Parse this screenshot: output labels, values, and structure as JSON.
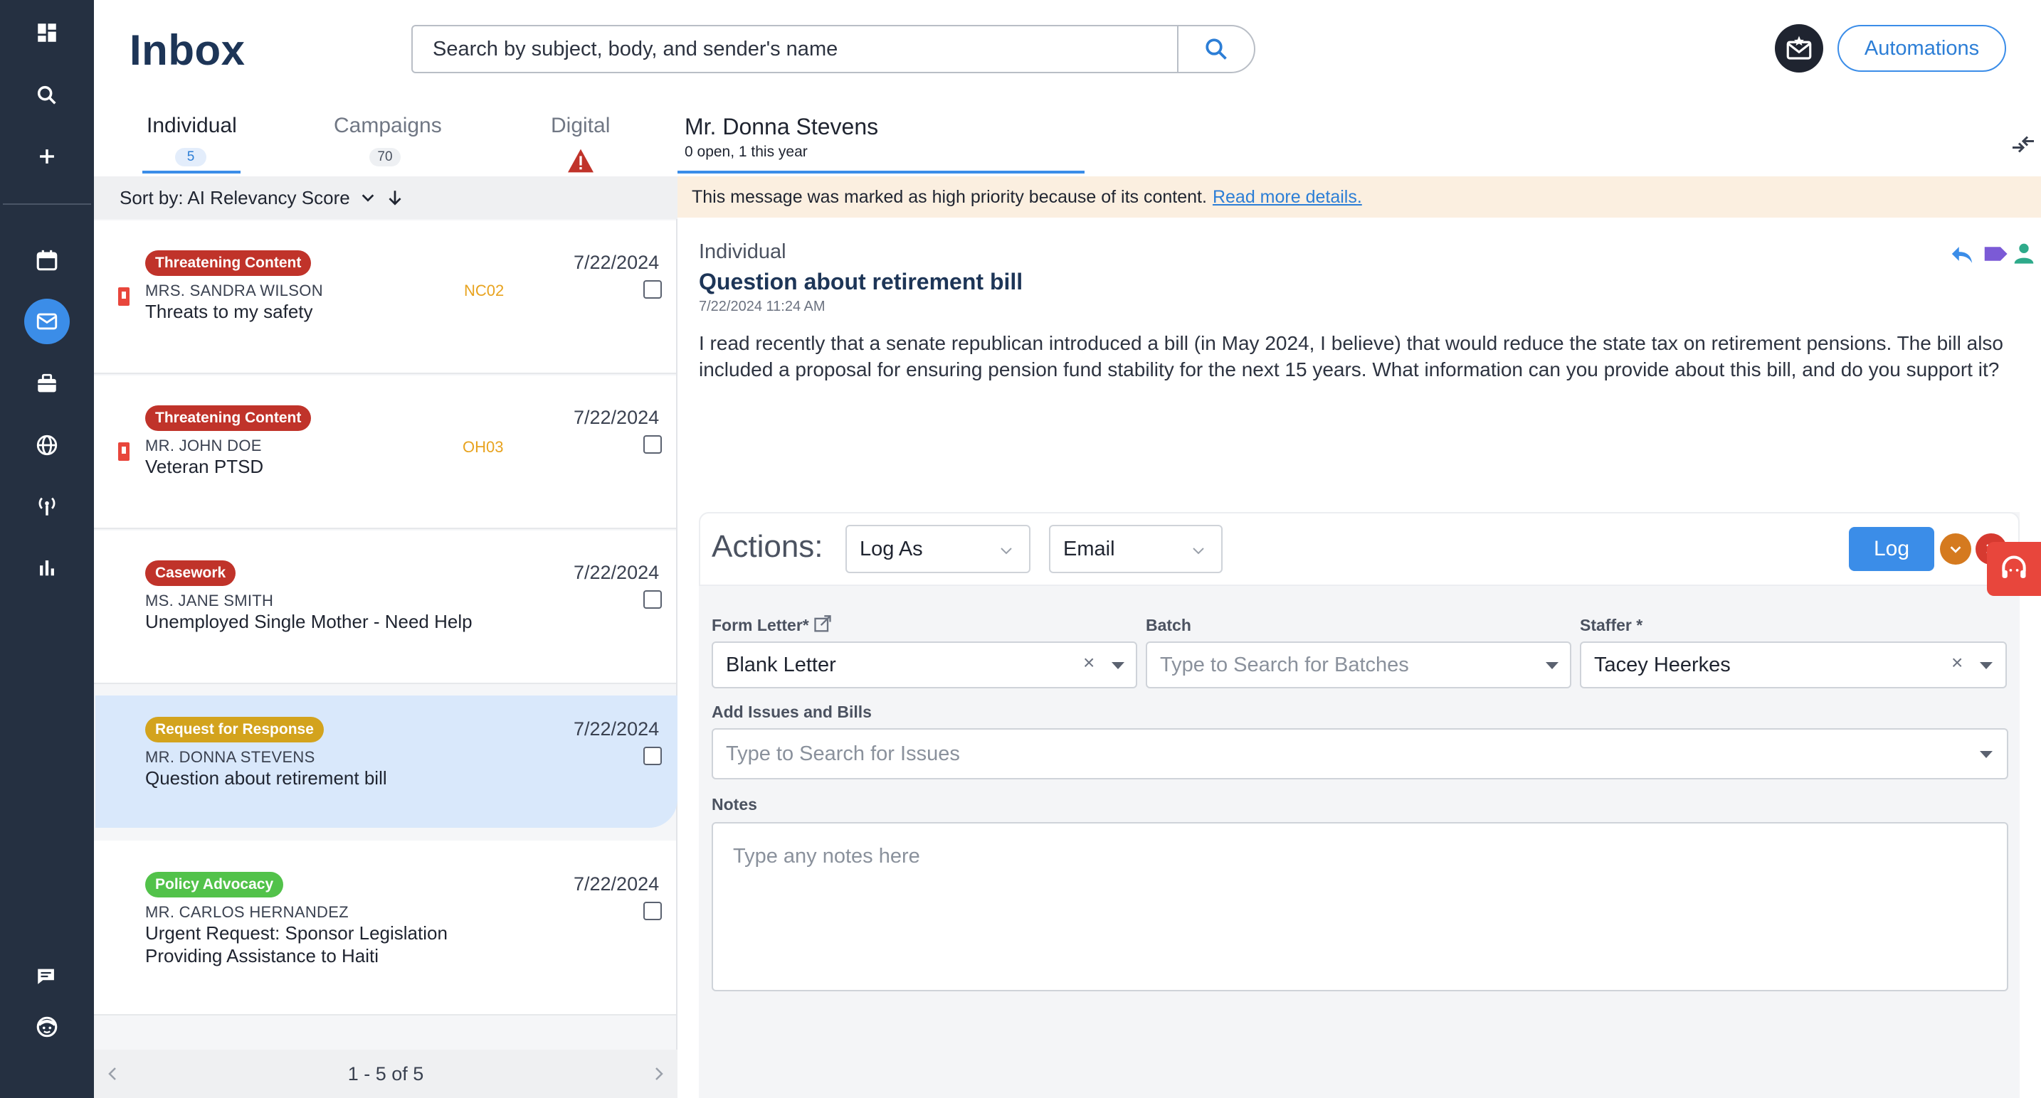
{
  "header": {
    "title": "Inbox",
    "search_placeholder": "Search by subject, body, and sender's name",
    "automations_label": "Automations"
  },
  "tabs": [
    {
      "label": "Individual",
      "count": "5"
    },
    {
      "label": "Campaigns",
      "count": "70"
    },
    {
      "label": "Digital"
    }
  ],
  "sort": {
    "label": "Sort by: AI Relevancy Score"
  },
  "messages": [
    {
      "tag": "Threatening Content",
      "tag_color": "#c0332a",
      "sender": "MRS. SANDRA WILSON",
      "subject": "Threats to my safety",
      "code": "NC02",
      "date": "7/22/2024"
    },
    {
      "tag": "Threatening Content",
      "tag_color": "#c0332a",
      "sender": "MR. JOHN DOE",
      "subject": "Veteran PTSD",
      "code": "OH03",
      "date": "7/22/2024"
    },
    {
      "tag": "Casework",
      "tag_color": "#c0332a",
      "sender": "MS. JANE SMITH",
      "subject": "Unemployed Single Mother - Need Help",
      "date": "7/22/2024"
    },
    {
      "tag": "Request for Response",
      "tag_color": "#d3a31d",
      "sender": "MR. DONNA STEVENS",
      "subject": "Question about retirement bill",
      "date": "7/22/2024"
    },
    {
      "tag": "Policy Advocacy",
      "tag_color": "#52c24a",
      "sender": "MR. CARLOS HERNANDEZ",
      "subject_line1": "Urgent Request: Sponsor Legislation",
      "subject_line2": "Providing Assistance to Haiti",
      "date": "7/22/2024"
    }
  ],
  "pager": {
    "label": "1 - 5 of 5"
  },
  "contact": {
    "name": "Mr. Donna Stevens",
    "summary": "0 open, 1 this year"
  },
  "banner": {
    "text": "This message was marked as high priority because of its content.",
    "link": "Read more details."
  },
  "detail": {
    "type": "Individual",
    "subject": "Question about retirement bill",
    "timestamp": "7/22/2024 11:24 AM",
    "body": "I read recently that a senate republican introduced a bill (in May 2024, I believe) that would reduce the state tax on retirement pensions. The bill also included a proposal for ensuring pension fund stability for the next 15 years. What information can you provide about this bill, and do you support it?"
  },
  "actions": {
    "label": "Actions:",
    "log_as": "Log As",
    "channel": "Email",
    "log_button": "Log",
    "form_letter_label": "Form Letter*",
    "form_letter_value": "Blank Letter",
    "batch_label": "Batch",
    "batch_placeholder": "Type to Search for Batches",
    "staffer_label": "Staffer *",
    "staffer_value": "Tacey Heerkes",
    "issues_label": "Add Issues and Bills",
    "issues_placeholder": "Type to Search for Issues",
    "notes_label": "Notes",
    "notes_placeholder": "Type any notes here"
  },
  "colors": {
    "rail": "#253041",
    "accent": "#3b8de8",
    "title": "#1d3557",
    "banner": "#fbefe0"
  }
}
